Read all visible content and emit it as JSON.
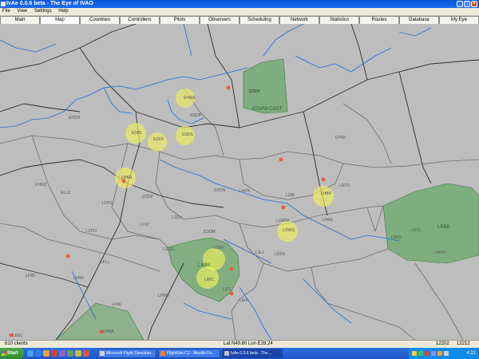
{
  "window": {
    "title": "IvAe 0.0.6 beta - The Eye of IVAO",
    "min_glyph": "_",
    "max_glyph": "□",
    "close_glyph": "×"
  },
  "menu": [
    "File",
    "View",
    "Settings",
    "Help"
  ],
  "tabs": [
    "Main",
    "Map",
    "Countries",
    "Controllers",
    "Pilots",
    "Observers",
    "Scheduling",
    "Network",
    "Statistics",
    "Routes",
    "Database",
    "My Eye"
  ],
  "active_tab": "Map",
  "map": {
    "airports": [
      "EDDP",
      "EDDF",
      "EDDL",
      "EHAM",
      "EHRD",
      "EBBR",
      "ELLX",
      "EDDH",
      "EDDB",
      "EDDN",
      "LFPO",
      "LFPG",
      "LSZH",
      "LSGG",
      "LFML",
      "LFLL",
      "LFMN",
      "LIMC",
      "LIPZ",
      "LOWW",
      "LKPR",
      "LHBP",
      "LZIB",
      "LJLJ",
      "LDZA",
      "LROP",
      "LRBS",
      "LFBO",
      "LFBD",
      "LEBL",
      "EPWA",
      "EPKK",
      "LOWI",
      "LIRF",
      "EDDM",
      "EDDS",
      "LFST",
      "LOWG",
      "LHKE",
      "LRTR",
      "LRCL"
    ],
    "region_labels": {
      "eddm_like": "EDWW-CAST",
      "lrbb": "LRBB",
      "limm": "LIMM",
      "eddp": "EDDP"
    },
    "colors": {
      "background": "#bdbdbd",
      "border": "#6a6a6a",
      "fir_line": "#2b2b2b",
      "water": "#1e6ad8",
      "sector_fill": "#6aa86a",
      "atc_circle": "#f0f05a",
      "pilot_marker": "#e06040"
    }
  },
  "status": {
    "clients": "610 clients",
    "coords": "Lat N49.80 Lon E28.24",
    "zoom1": "12202",
    "zoom2": "12212"
  },
  "taskbar": {
    "start": "Start",
    "tasks": [
      "Microsoft Flight Simulator...",
      "FlightSim.CZ - Mozilla Fir...",
      "IvAe 0.0.6 beta - The ..."
    ],
    "clock": "4:21"
  }
}
